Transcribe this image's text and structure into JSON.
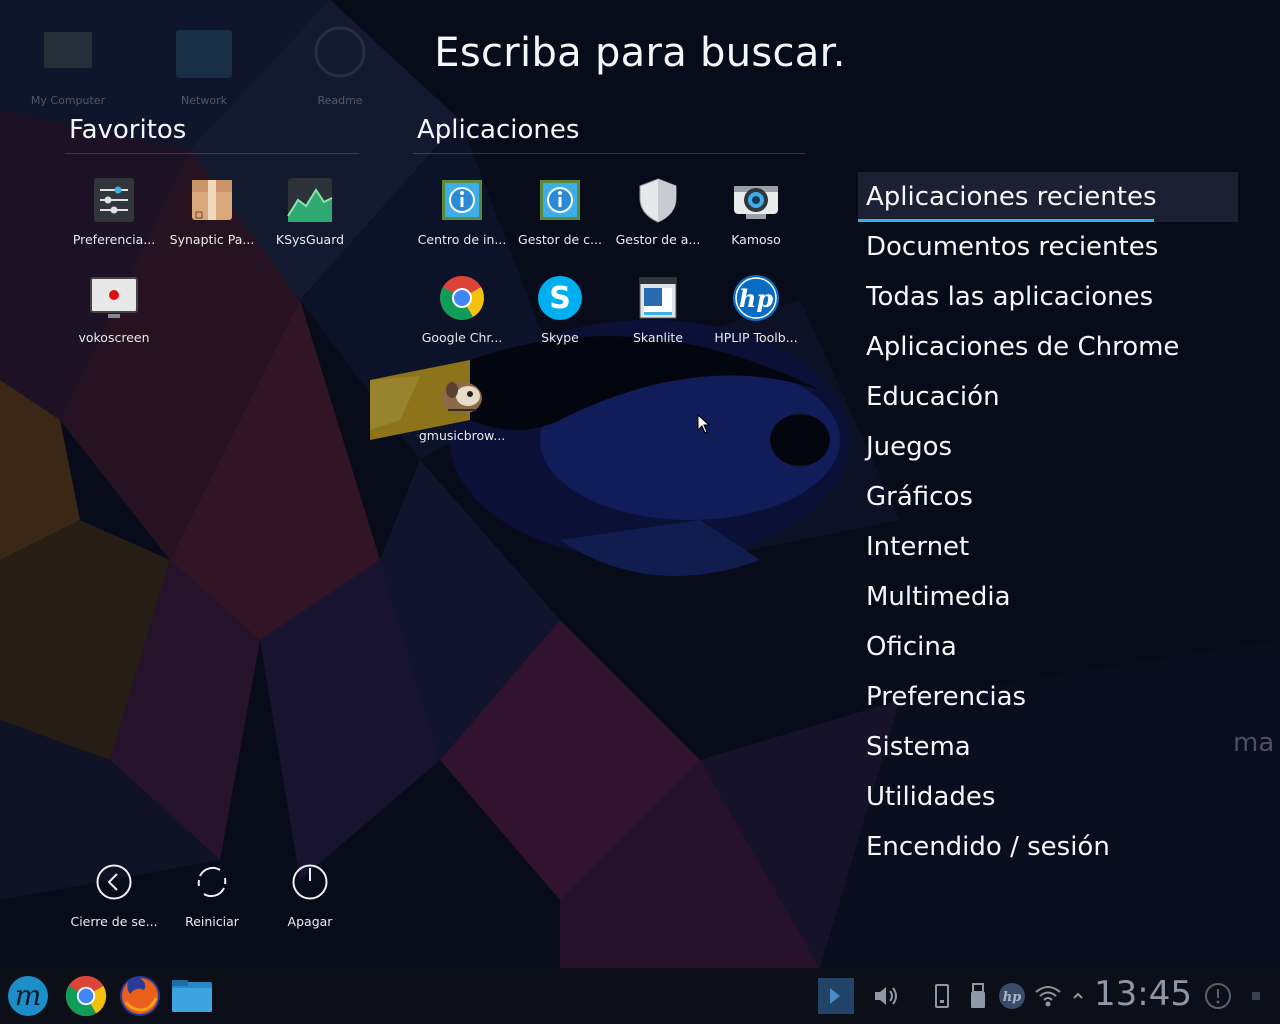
{
  "desktop": {
    "ghost_icons": [
      "My Computer",
      "Network",
      "Readme"
    ],
    "ghost_text": "ma"
  },
  "launcher": {
    "search_prompt": "Escriba para buscar.",
    "favorites": {
      "title": "Favoritos",
      "items": [
        {
          "label": "Preferencia...",
          "icon": "settings-sliders-icon"
        },
        {
          "label": "Synaptic Pa...",
          "icon": "package-box-icon"
        },
        {
          "label": "KSysGuard",
          "icon": "system-monitor-icon"
        },
        {
          "label": "vokoscreen",
          "icon": "screen-recorder-icon"
        }
      ]
    },
    "applications": {
      "title": "Aplicaciones",
      "items": [
        {
          "label": "Centro de in...",
          "icon": "info-center-icon"
        },
        {
          "label": "Gestor de c...",
          "icon": "info-manager-icon"
        },
        {
          "label": "Gestor de a...",
          "icon": "shield-icon"
        },
        {
          "label": "Kamoso",
          "icon": "webcam-icon"
        },
        {
          "label": "Google Chr...",
          "icon": "chrome-icon"
        },
        {
          "label": "Skype",
          "icon": "skype-icon"
        },
        {
          "label": "Skanlite",
          "icon": "scanner-icon"
        },
        {
          "label": "HPLIP Toolb...",
          "icon": "hp-icon"
        },
        {
          "label": "gmusicbrow...",
          "icon": "music-browser-icon"
        }
      ]
    },
    "categories": [
      "Aplicaciones recientes",
      "Documentos recientes",
      "Todas las aplicaciones",
      "Aplicaciones de Chrome",
      "Educación",
      "Juegos",
      "Gráficos",
      "Internet",
      "Multimedia",
      "Oficina",
      "Preferencias",
      "Sistema",
      "Utilidades",
      "Encendido / sesión"
    ],
    "active_category": "Aplicaciones recientes",
    "power": [
      {
        "label": "Cierre de se...",
        "icon": "logout-icon"
      },
      {
        "label": "Reiniciar",
        "icon": "restart-icon"
      },
      {
        "label": "Apagar",
        "icon": "power-off-icon"
      }
    ]
  },
  "taskbar": {
    "launchers": [
      "menu-logo-icon",
      "chrome-icon",
      "firefox-icon",
      "file-manager-icon"
    ],
    "tray": [
      "show-desktop-icon",
      "volume-icon",
      "device-notifier-icon",
      "usb-icon",
      "hp-tray-icon",
      "wifi-icon",
      "expand-tray-icon"
    ],
    "clock": "13:45"
  },
  "colors": {
    "accent": "#3daee9",
    "background": "#0a0e1c"
  }
}
